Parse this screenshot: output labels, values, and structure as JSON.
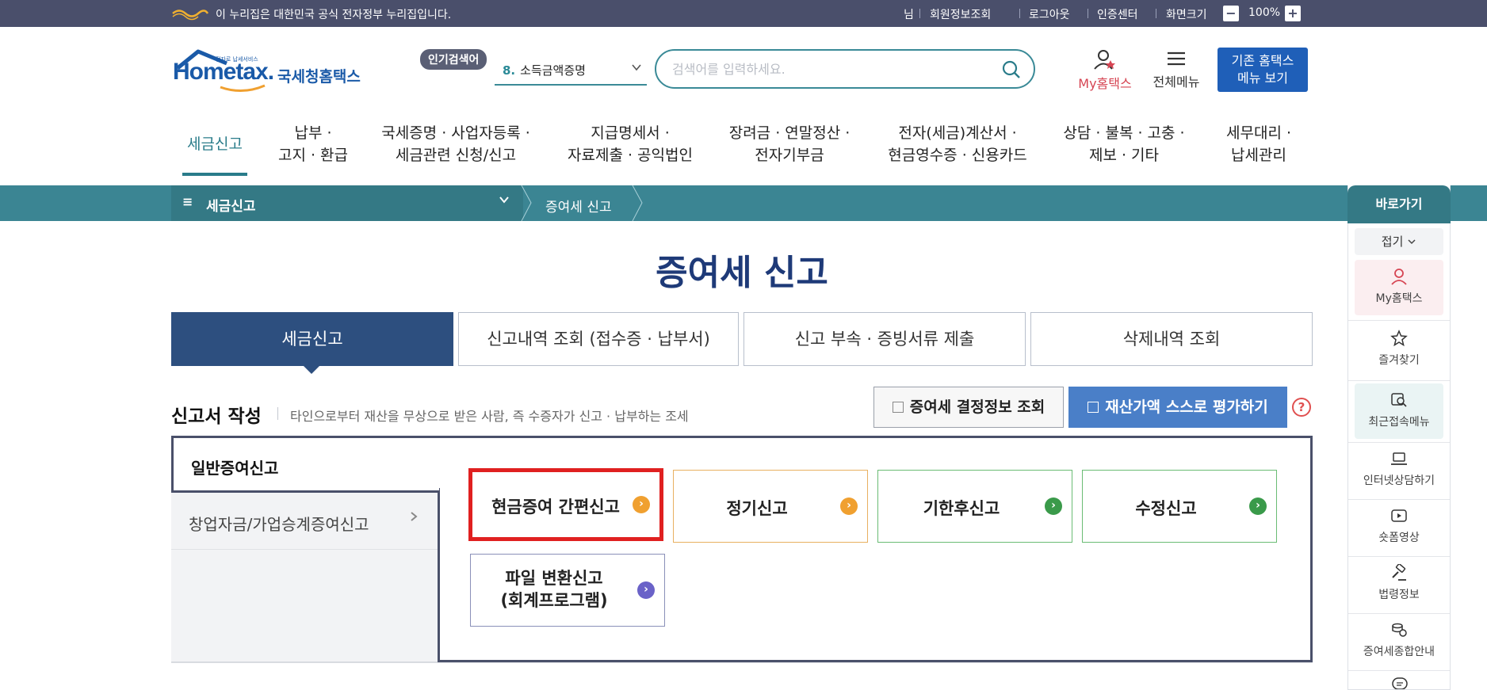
{
  "gov_banner": {
    "text": "이 누리집은 대한민국 공식 전자정부 누리집입니다.",
    "utils": [
      "님",
      "회원정보조회",
      "로그아웃",
      "인증센터",
      "화면크기"
    ],
    "zoom_level": "100%",
    "zoom_minus": "−",
    "zoom_plus": "+"
  },
  "header": {
    "logo_small": "전자로 납세서비스",
    "logo_main": "Hometax.",
    "logo_kr": "국세청홈택스",
    "popular_label": "인기검색어",
    "popular_num": "8.",
    "popular_text": "소득금액증명",
    "search_placeholder": "검색어를 입력하세요.",
    "my_hometax": "My홈택스",
    "all_menu": "전체메뉴",
    "old_menu_line1": "기존 홈택스",
    "old_menu_line2": "메뉴 보기"
  },
  "gnb": [
    {
      "l1": "세금신고",
      "l2": ""
    },
    {
      "l1": "납부 ·",
      "l2": "고지 · 환급"
    },
    {
      "l1": "국세증명 · 사업자등록 ·",
      "l2": "세금관련 신청/신고"
    },
    {
      "l1": "지급명세서 ·",
      "l2": "자료제출 · 공익법인"
    },
    {
      "l1": "장려금 · 연말정산 ·",
      "l2": "전자기부금"
    },
    {
      "l1": "전자(세금)계산서 ·",
      "l2": "현금영수증 · 신용카드"
    },
    {
      "l1": "상담 · 불복 · 고충 ·",
      "l2": "제보 · 기타"
    },
    {
      "l1": "세무대리 ·",
      "l2": "납세관리"
    }
  ],
  "breadcrumb": {
    "menu_icon": "≡",
    "menu": "세금신고",
    "current": "증여세 신고"
  },
  "quick_panel": {
    "title": "바로가기",
    "fold": "접기",
    "items": [
      "My홈택스",
      "즐겨찾기",
      "최근접속메뉴",
      "인터넷상담하기",
      "숏폼영상",
      "법령정보",
      "증여세종합안내"
    ]
  },
  "page": {
    "title": "증여세 신고",
    "tabs": [
      "세금신고",
      "신고내역 조회 (접수증 · 납부서)",
      "신고 부속 · 증빙서류 제출",
      "삭제내역 조회"
    ],
    "section_title": "신고서 작성",
    "section_desc": "타인으로부터 재산을 무상으로 받은 사람, 즉 수증자가 신고 · 납부하는 조세",
    "btn_lookup": "증여세 결정정보 조회",
    "btn_evaluate": "재산가액 스스로 평가하기",
    "help": "?"
  },
  "side_menu": [
    "일반증여신고",
    "창업자금/가업승계증여신고"
  ],
  "cards": [
    {
      "label": "현금증여 간편신고",
      "label2": "",
      "color": "#f0a030"
    },
    {
      "label": "정기신고",
      "label2": "",
      "color": "#f0a030"
    },
    {
      "label": "기한후신고",
      "label2": "",
      "color": "#3a9a4a"
    },
    {
      "label": "수정신고",
      "label2": "",
      "color": "#3a9a4a"
    },
    {
      "label": "파일 변환신고",
      "label2": "(회계프로그램)",
      "color": "#6a62c8"
    }
  ],
  "colors": {
    "gov_bar": "#4a4f6b",
    "teal": "#3b8593",
    "navy": "#2d4f7f",
    "primary_blue": "#4a7fc8",
    "highlight_red": "#e02020"
  }
}
